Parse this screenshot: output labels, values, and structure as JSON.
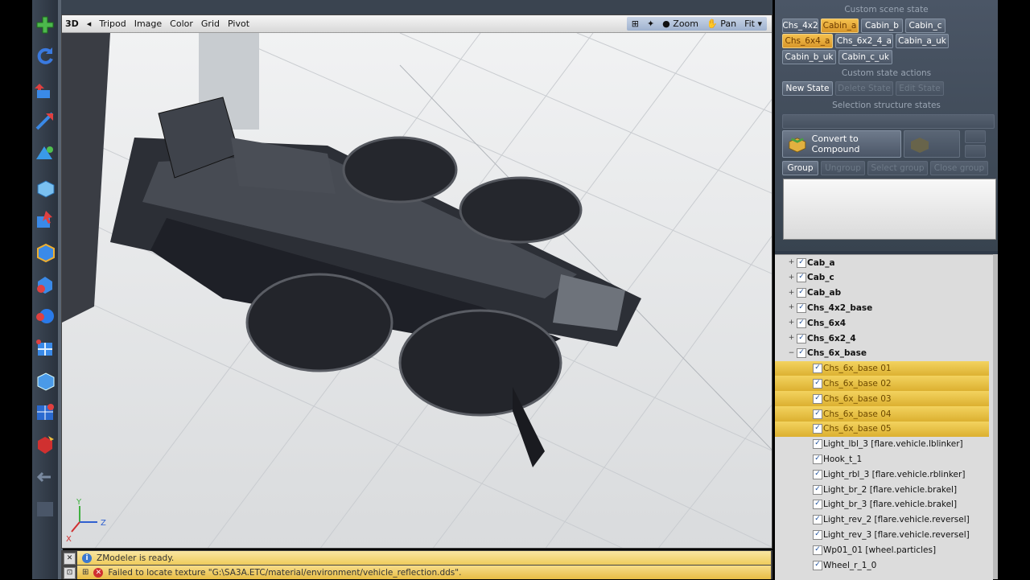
{
  "viewport": {
    "mode": "3D",
    "menus": [
      "Tripod",
      "Image",
      "Color",
      "Grid",
      "Pivot"
    ],
    "view_tools": [
      "Zoom",
      "Pan",
      "Fit"
    ],
    "axes": {
      "x": "X",
      "y": "Y",
      "z": "Z"
    }
  },
  "toolbar_icons": [
    "add-icon",
    "rotate-icon",
    "move-icon",
    "scale-icon",
    "transform-icon",
    "box-icon",
    "select-icon",
    "cube-icon",
    "sphere-icon",
    "material-icon",
    "slice-icon",
    "cube-solid-icon",
    "uv-icon",
    "paint-icon",
    "arrow-icon"
  ],
  "state_panel": {
    "custom_scene_state": "Custom scene state",
    "states": [
      "Chs_4x2",
      "Cabin_a",
      "Cabin_b",
      "Cabin_c",
      "Chs_6x4_a",
      "Chs_6x2_4_a",
      "Cabin_a_uk",
      "Cabin_b_uk",
      "Cabin_c_uk"
    ],
    "active_states": [
      "Cabin_a",
      "Chs_6x4_a"
    ],
    "custom_state_actions": "Custom state actions",
    "new_state": "New State",
    "delete_state": "Delete State",
    "edit_state": "Edit State",
    "selection_structure_states": "Selection structure states",
    "convert_label": "Convert to Compound",
    "group": "Group",
    "ungroup": "Ungroup",
    "select_group": "Select group",
    "close_group": "Close group"
  },
  "tree": [
    {
      "label": "Cab_a",
      "level": 0,
      "expander": "+",
      "checked": true,
      "selected": false
    },
    {
      "label": "Cab_c",
      "level": 0,
      "expander": "+",
      "checked": true,
      "selected": false
    },
    {
      "label": "Cab_ab",
      "level": 0,
      "expander": "+",
      "checked": true,
      "selected": false
    },
    {
      "label": "Chs_4x2_base",
      "level": 0,
      "expander": "+",
      "checked": true,
      "selected": false
    },
    {
      "label": "Chs_6x4",
      "level": 0,
      "expander": "+",
      "checked": true,
      "selected": false
    },
    {
      "label": "Chs_6x2_4",
      "level": 0,
      "expander": "+",
      "checked": true,
      "selected": false
    },
    {
      "label": "Chs_6x_base",
      "level": 0,
      "expander": "−",
      "checked": true,
      "selected": false
    },
    {
      "label": "Chs_6x_base 01",
      "level": 1,
      "checked": true,
      "selected": true
    },
    {
      "label": "Chs_6x_base 02",
      "level": 1,
      "checked": true,
      "selected": true
    },
    {
      "label": "Chs_6x_base 03",
      "level": 1,
      "checked": true,
      "selected": true
    },
    {
      "label": "Chs_6x_base 04",
      "level": 1,
      "checked": true,
      "selected": true
    },
    {
      "label": "Chs_6x_base 05",
      "level": 1,
      "checked": true,
      "selected": true
    },
    {
      "label": "Light_lbl_3 [flare.vehicle.lblinker]",
      "level": 1,
      "checked": true,
      "selected": false
    },
    {
      "label": "Hook_t_1",
      "level": 1,
      "checked": true,
      "selected": false
    },
    {
      "label": "Light_rbl_3 [flare.vehicle.rblinker]",
      "level": 1,
      "checked": true,
      "selected": false
    },
    {
      "label": "Light_br_2 [flare.vehicle.brakel]",
      "level": 1,
      "checked": true,
      "selected": false
    },
    {
      "label": "Light_br_3 [flare.vehicle.brakel]",
      "level": 1,
      "checked": true,
      "selected": false
    },
    {
      "label": "Light_rev_2 [flare.vehicle.reversel]",
      "level": 1,
      "checked": true,
      "selected": false
    },
    {
      "label": "Light_rev_3 [flare.vehicle.reversel]",
      "level": 1,
      "checked": true,
      "selected": false
    },
    {
      "label": "Wp01_01 [wheel.particles]",
      "level": 1,
      "checked": true,
      "selected": false
    },
    {
      "label": "Wheel_r_1_0",
      "level": 1,
      "checked": true,
      "selected": false
    }
  ],
  "status": {
    "ready": "ZModeler is ready.",
    "error": "Failed to locate texture \"G:\\SA3A.ETC/material/environment/vehicle_reflection.dds\"."
  },
  "colors": {
    "accent": "#f0c040",
    "panel": "#3b4553",
    "viewport": "#dfe1e3"
  }
}
